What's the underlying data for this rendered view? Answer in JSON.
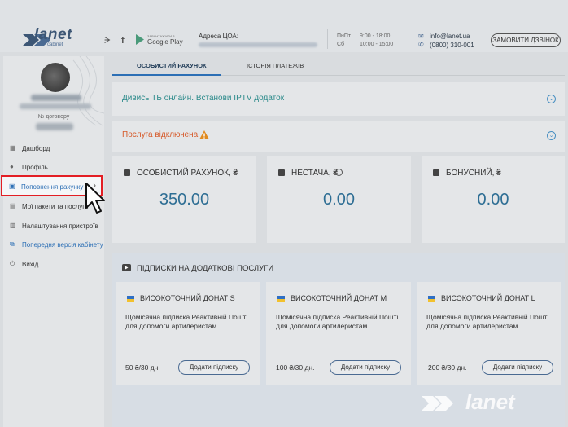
{
  "header": {
    "logo_text": "lanet",
    "logo_sub": "cabinet",
    "google_play_small": "ЗАВАНТАЖИТИ З",
    "google_play_large": "Google Play",
    "address_title": "Адреса ЦОА:",
    "schedule": [
      {
        "days": "ПнПт",
        "hours": "9:00 - 18:00"
      },
      {
        "days": "Сб",
        "hours": "10:00 - 15:00"
      }
    ],
    "email": "info@lanet.ua",
    "phone": "(0800) 310-001",
    "callback_label": "ЗАМОВИТИ ДЗВІНОК"
  },
  "sidebar": {
    "contract_label": "№ договору",
    "items": [
      {
        "label": "Дашборд",
        "icon": "dashboard-icon"
      },
      {
        "label": "Профіль",
        "icon": "user-icon"
      },
      {
        "label": "Поповнення рахунку",
        "icon": "payment-icon"
      },
      {
        "label": "Мої пакети та послуги",
        "icon": "packages-icon"
      },
      {
        "label": "Налаштування пристроїв",
        "icon": "settings-icon"
      },
      {
        "label": "Попередня версія кабінету",
        "icon": "external-link-icon"
      },
      {
        "label": "Вихід",
        "icon": "logout-icon"
      }
    ]
  },
  "tabs": [
    {
      "label": "ОСОБИСТИЙ РАХУНОК",
      "active": true
    },
    {
      "label": "ІСТОРІЯ ПЛАТЕЖІВ",
      "active": false
    }
  ],
  "accordions": {
    "iptv": "Дивись ТБ онлайн. Встанови IPTV додаток",
    "service_off": "Послуга відключена"
  },
  "balances": [
    {
      "title": "ОСОБИСТИЙ РАХУНОК, ₴",
      "value": "350.00"
    },
    {
      "title": "НЕСТАЧА, ₴",
      "value": "0.00"
    },
    {
      "title": "БОНУСНИЙ, ₴",
      "value": "0.00"
    }
  ],
  "subscriptions": {
    "section_title": "ПІДПИСКИ НА ДОДАТКОВІ ПОСЛУГИ",
    "items": [
      {
        "name": "ВИСОКОТОЧНИЙ ДОНАТ S",
        "desc": "Щомісячна підписка Реактивній Пошті для допомоги артилеристам",
        "price": "50 ₴/30 дн.",
        "button": "Додати підписку"
      },
      {
        "name": "ВИСОКОТОЧНИЙ ДОНАТ M",
        "desc": "Щомісячна підписка Реактивній Пошті для допомоги артилеристам",
        "price": "100 ₴/30 дн.",
        "button": "Додати підписку"
      },
      {
        "name": "ВИСОКОТОЧНИЙ ДОНАТ L",
        "desc": "Щомісячна підписка Реактивній Пошті для допомоги артилеристам",
        "price": "200 ₴/30 дн.",
        "button": "Додати підписку"
      }
    ]
  },
  "colors": {
    "accent": "#2c6fb5",
    "value": "#2e6e94",
    "highlight": "#e31e24",
    "warning": "#e08a1e",
    "service_off": "#d65a2a"
  },
  "watermark": "lanet"
}
